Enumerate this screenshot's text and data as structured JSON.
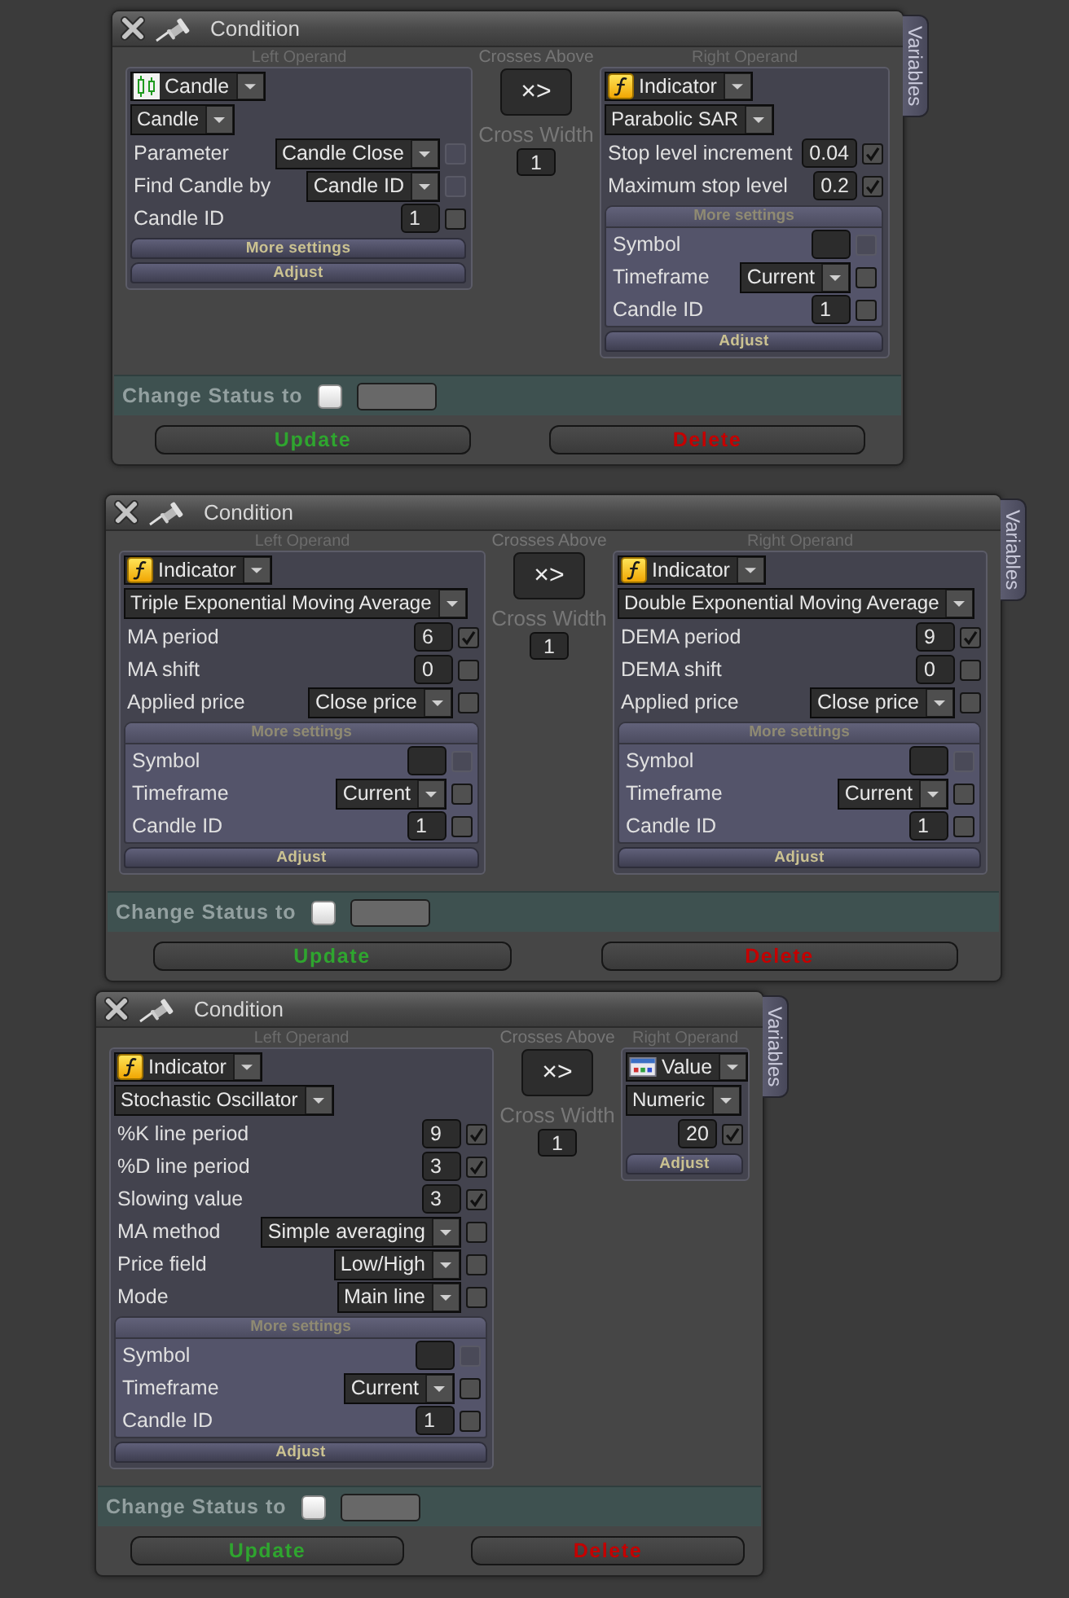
{
  "panels": [
    {
      "title": "Condition",
      "side_tab": "Variables",
      "left_operand": {
        "heading": "Left Operand",
        "kind": "candle",
        "type": "Candle",
        "subtype": "Candle",
        "rows": [
          {
            "kind": "select",
            "label": "Parameter",
            "value": "Candle Close",
            "checked": false,
            "disabled": true
          },
          {
            "kind": "select",
            "label": "Find Candle by",
            "value": "Candle ID",
            "checked": false,
            "disabled": true
          },
          {
            "kind": "input",
            "label": "Candle ID",
            "value": "1",
            "checked": false,
            "disabled": false
          }
        ],
        "more_settings": {
          "label": "More settings",
          "expanded": false
        },
        "adjust": "Adjust"
      },
      "operator": {
        "heading": "Crosses Above",
        "symbol": "×>",
        "width_label": "Cross Width",
        "width_value": "1"
      },
      "right_operand": {
        "heading": "Right Operand",
        "kind": "indicator",
        "type": "Indicator",
        "subtype": "Parabolic SAR",
        "rows": [
          {
            "kind": "input",
            "label": "Stop level increment",
            "value": "0.04",
            "checked": true,
            "disabled": false
          },
          {
            "kind": "input",
            "label": "Maximum stop level",
            "value": "0.2",
            "checked": true,
            "disabled": false
          }
        ],
        "more_settings": {
          "label": "More settings",
          "expanded": true,
          "rows": [
            {
              "kind": "input",
              "label": "Symbol",
              "checked": false,
              "disabled": true
            },
            {
              "kind": "select",
              "label": "Timeframe",
              "value": "Current",
              "checked": false,
              "disabled": false
            },
            {
              "kind": "input",
              "label": "Candle ID",
              "value": "1",
              "checked": false,
              "disabled": false
            }
          ]
        },
        "adjust": "Adjust"
      },
      "status": {
        "label": "Change Status to",
        "checked": false
      },
      "buttons": [
        {
          "kind": "update",
          "label": "Update"
        },
        {
          "kind": "delete",
          "label": "Delete"
        }
      ]
    },
    {
      "title": "Condition",
      "side_tab": "Variables",
      "left_operand": {
        "heading": "Left Operand",
        "kind": "indicator",
        "type": "Indicator",
        "subtype": "Triple Exponential Moving Average",
        "rows": [
          {
            "kind": "input",
            "label": "MA period",
            "value": "6",
            "checked": true,
            "disabled": false
          },
          {
            "kind": "input",
            "label": "MA shift",
            "value": "0",
            "checked": false,
            "disabled": false
          },
          {
            "kind": "select",
            "label": "Applied price",
            "value": "Close price",
            "checked": false,
            "disabled": false
          }
        ],
        "more_settings": {
          "label": "More settings",
          "expanded": true,
          "rows": [
            {
              "kind": "input",
              "label": "Symbol",
              "checked": false,
              "disabled": true
            },
            {
              "kind": "select",
              "label": "Timeframe",
              "value": "Current",
              "checked": false,
              "disabled": false
            },
            {
              "kind": "input",
              "label": "Candle ID",
              "value": "1",
              "checked": false,
              "disabled": false
            }
          ]
        },
        "adjust": "Adjust"
      },
      "operator": {
        "heading": "Crosses Above",
        "symbol": "×>",
        "width_label": "Cross Width",
        "width_value": "1"
      },
      "right_operand": {
        "heading": "Right Operand",
        "kind": "indicator",
        "type": "Indicator",
        "subtype": "Double Exponential Moving Average",
        "rows": [
          {
            "kind": "input",
            "label": "DEMA period",
            "value": "9",
            "checked": true,
            "disabled": false
          },
          {
            "kind": "input",
            "label": "DEMA shift",
            "value": "0",
            "checked": false,
            "disabled": false
          },
          {
            "kind": "select",
            "label": "Applied price",
            "value": "Close price",
            "checked": false,
            "disabled": false
          }
        ],
        "more_settings": {
          "label": "More settings",
          "expanded": true,
          "rows": [
            {
              "kind": "input",
              "label": "Symbol",
              "checked": false,
              "disabled": true
            },
            {
              "kind": "select",
              "label": "Timeframe",
              "value": "Current",
              "checked": false,
              "disabled": false
            },
            {
              "kind": "input",
              "label": "Candle ID",
              "value": "1",
              "checked": false,
              "disabled": false
            }
          ]
        },
        "adjust": "Adjust"
      },
      "status": {
        "label": "Change Status to",
        "checked": false
      },
      "buttons": [
        {
          "kind": "update",
          "label": "Update"
        },
        {
          "kind": "delete",
          "label": "Delete"
        }
      ]
    },
    {
      "title": "Condition",
      "side_tab": "Variables",
      "left_operand": {
        "heading": "Left Operand",
        "kind": "indicator",
        "type": "Indicator",
        "subtype": "Stochastic Oscillator",
        "rows": [
          {
            "kind": "input",
            "label": "%K line period",
            "value": "9",
            "checked": true,
            "disabled": false
          },
          {
            "kind": "input",
            "label": "%D line period",
            "value": "3",
            "checked": true,
            "disabled": false
          },
          {
            "kind": "input",
            "label": "Slowing value",
            "value": "3",
            "checked": true,
            "disabled": false
          },
          {
            "kind": "select",
            "label": "MA method",
            "value": "Simple averaging",
            "checked": false,
            "disabled": false
          },
          {
            "kind": "select",
            "label": "Price field",
            "value": "Low/High",
            "checked": false,
            "disabled": false
          },
          {
            "kind": "select",
            "label": "Mode",
            "value": "Main line",
            "checked": false,
            "disabled": false
          }
        ],
        "more_settings": {
          "label": "More settings",
          "expanded": true,
          "rows": [
            {
              "kind": "input",
              "label": "Symbol",
              "checked": false,
              "disabled": true
            },
            {
              "kind": "select",
              "label": "Timeframe",
              "value": "Current",
              "checked": false,
              "disabled": false
            },
            {
              "kind": "input",
              "label": "Candle ID",
              "value": "1",
              "checked": false,
              "disabled": false
            }
          ]
        },
        "adjust": "Adjust"
      },
      "operator": {
        "heading": "Crosses Above",
        "symbol": "×>",
        "width_label": "Cross Width",
        "width_value": "1"
      },
      "right_operand": {
        "heading": "Right Operand",
        "kind": "value",
        "type": "Value",
        "subtype": "Numeric",
        "rows": [
          {
            "kind": "input",
            "value": "20",
            "checked": true,
            "disabled": false
          }
        ],
        "adjust": "Adjust"
      },
      "status": {
        "label": "Change Status to",
        "checked": false
      },
      "buttons": [
        {
          "kind": "update",
          "label": "Update"
        },
        {
          "kind": "delete",
          "label": "Delete"
        }
      ]
    }
  ]
}
